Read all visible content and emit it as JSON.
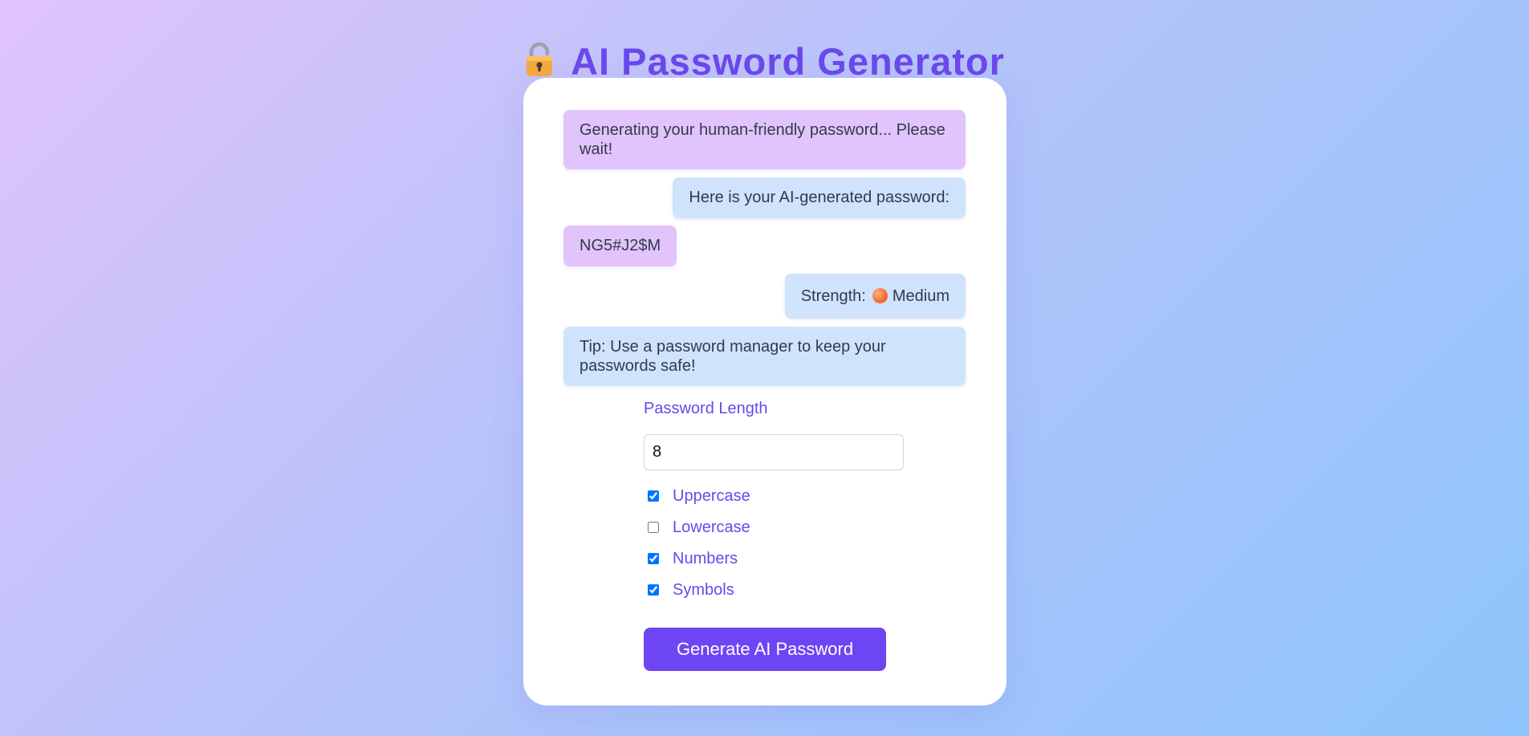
{
  "header": {
    "title": "AI Password Generator",
    "icon": "lock-icon"
  },
  "chat": {
    "messages": [
      {
        "text": "Generating your human-friendly password... Please wait!",
        "style": "purple"
      },
      {
        "text": "Here is your AI-generated password:",
        "style": "blue"
      },
      {
        "text": "NG5#J2$M",
        "style": "purple"
      },
      {
        "strength_label": "Strength:",
        "strength_value": "Medium",
        "icon": "orange-circle-icon",
        "style": "blue"
      },
      {
        "text": "Tip: Use a password manager to keep your passwords safe!",
        "style": "blue"
      }
    ]
  },
  "controls": {
    "length_label": "Password Length",
    "length_value": "8",
    "options": [
      {
        "label": "Uppercase",
        "checked": true
      },
      {
        "label": "Lowercase",
        "checked": false
      },
      {
        "label": "Numbers",
        "checked": true
      },
      {
        "label": "Symbols",
        "checked": true
      }
    ],
    "generate_label": "Generate AI Password"
  },
  "colors": {
    "accent": "#6a48ec",
    "button": "#6e45f5",
    "bubble_purple": "#e1c4fb",
    "bubble_blue": "#cfe3fd"
  }
}
